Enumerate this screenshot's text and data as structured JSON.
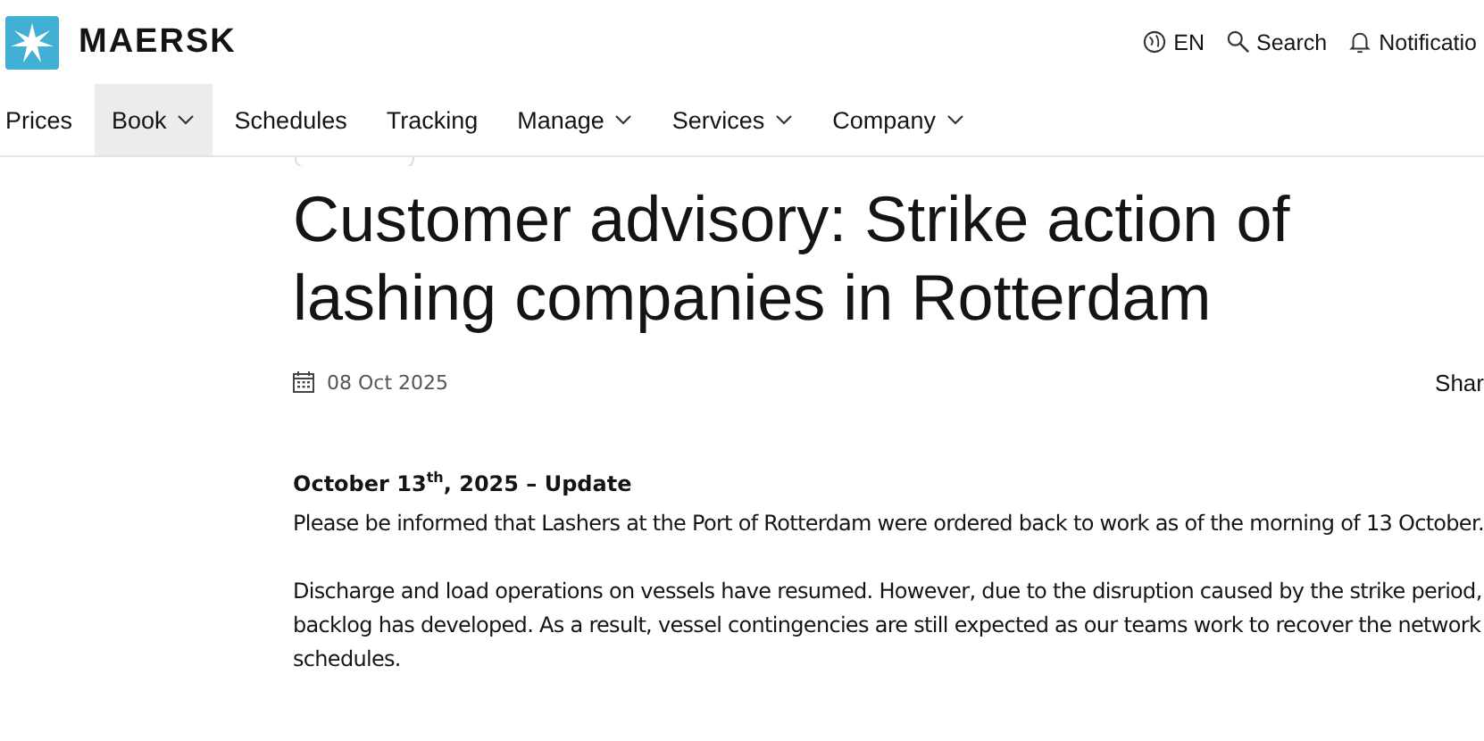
{
  "header": {
    "brand": "MAERSK",
    "utilities": [
      {
        "kind": "language",
        "label": "EN"
      },
      {
        "kind": "search",
        "label": "Search"
      },
      {
        "kind": "notifications",
        "label": "Notificatio"
      }
    ]
  },
  "nav": [
    {
      "label": "Prices",
      "dropdown": false,
      "selected": false
    },
    {
      "label": "Book",
      "dropdown": true,
      "selected": true
    },
    {
      "label": "Schedules",
      "dropdown": false,
      "selected": false
    },
    {
      "label": "Tracking",
      "dropdown": false,
      "selected": false
    },
    {
      "label": "Manage",
      "dropdown": true,
      "selected": false
    },
    {
      "label": "Services",
      "dropdown": true,
      "selected": false
    },
    {
      "label": "Company",
      "dropdown": true,
      "selected": false
    }
  ],
  "article": {
    "title": "Customer advisory: Strike action of lashing companies in Rotterdam",
    "date": "08 Oct 2025",
    "share": "Shar",
    "update_heading": "October 13$^{th}$, 2025 – Update",
    "paragraphs": [
      {
        "lines": [
          "Please be informed that Lashers at the Port of Rotterdam were ordered back to work as of the morning of 13 October."
        ]
      },
      {
        "lines": [
          "Discharge and load operations on vessels have resumed. However, due to the disruption caused by the strike period,",
          "backlog has developed. As a result, vessel contingencies are still expected as our teams work to recover the network",
          "schedules."
        ]
      }
    ]
  }
}
